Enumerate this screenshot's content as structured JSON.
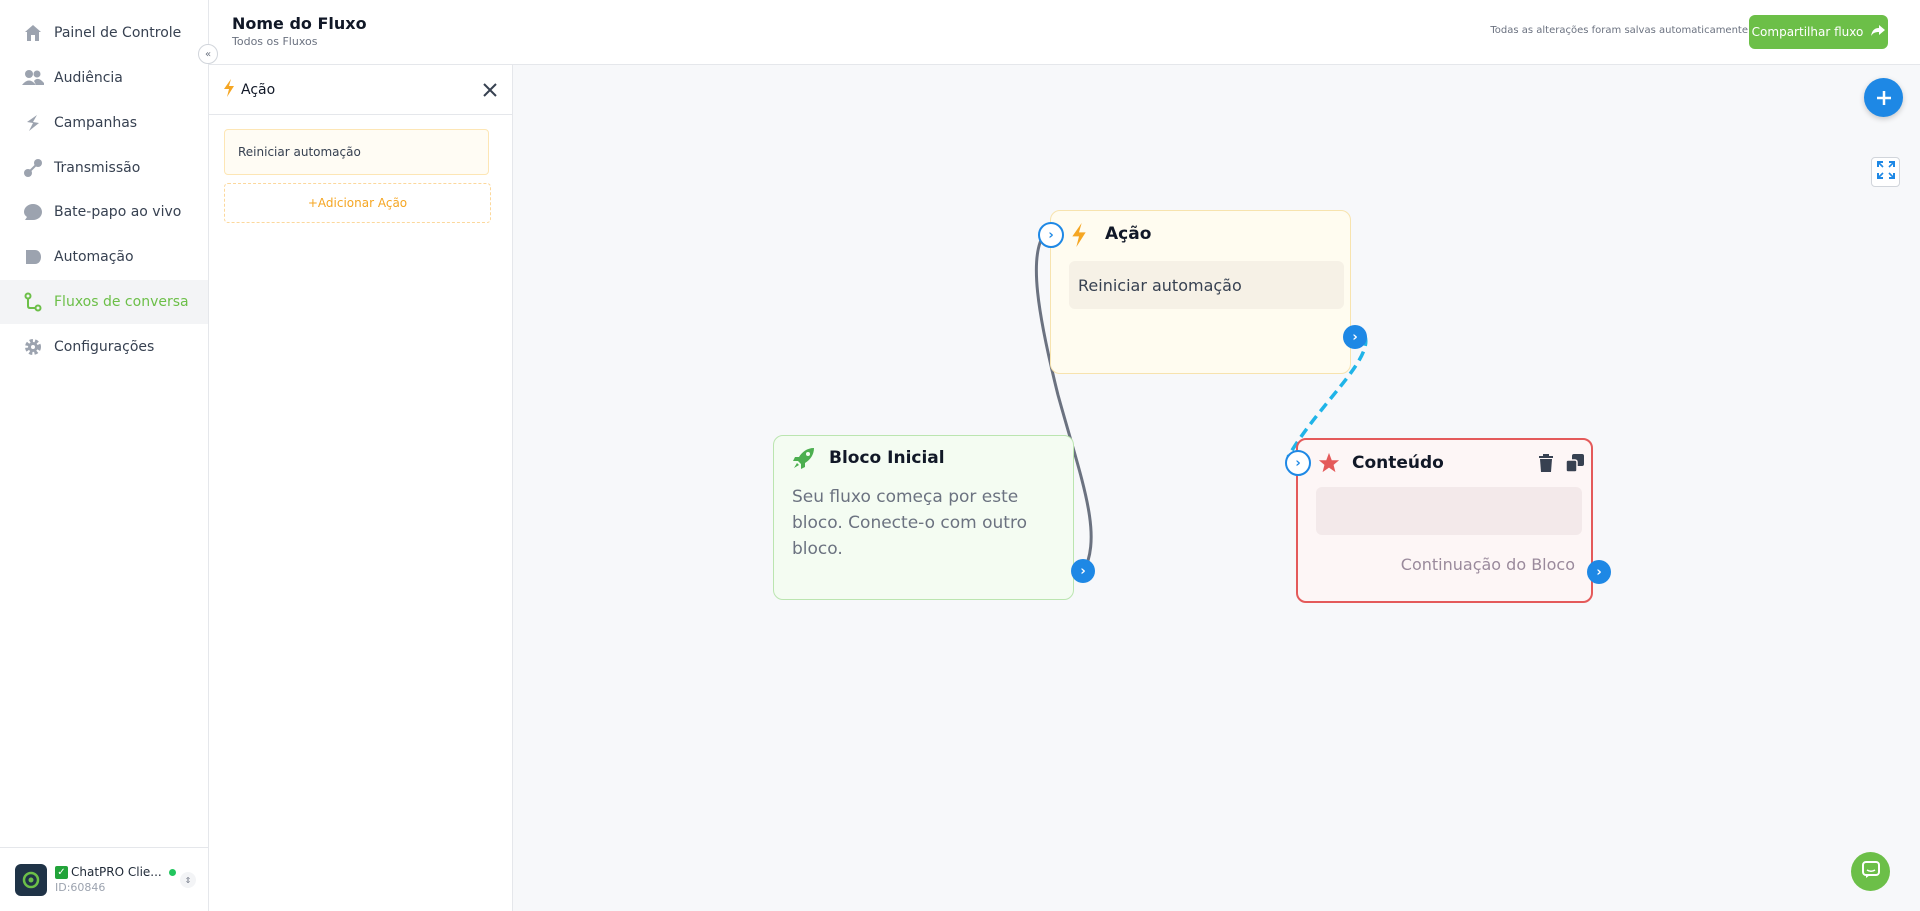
{
  "sidebar": {
    "items": [
      {
        "label": "Painel de Controle",
        "icon": "home-icon"
      },
      {
        "label": "Audiência",
        "icon": "users-icon"
      },
      {
        "label": "Campanhas",
        "icon": "campaigns-icon"
      },
      {
        "label": "Transmissão",
        "icon": "broadcast-icon"
      },
      {
        "label": "Bate-papo ao vivo",
        "icon": "chat-bubble-icon"
      },
      {
        "label": "Automação",
        "icon": "automation-icon"
      },
      {
        "label": "Fluxos de conversa",
        "icon": "flow-icon",
        "active": true
      },
      {
        "label": "Configurações",
        "icon": "gear-icon"
      }
    ],
    "collapse_icon": "double-chevron-left-icon",
    "account": {
      "name": "ChatPRO Clie...",
      "id": "ID:60846",
      "status_color": "#22c55e"
    }
  },
  "header": {
    "title": "Nome do Fluxo",
    "subtitle": "Todos os Fluxos",
    "saved_text": "Todas as alterações foram salvas automaticamente",
    "share_label": "Compartilhar fluxo"
  },
  "panel": {
    "title": "Ação",
    "action_item": "Reiniciar automação",
    "add_action": "+Adicionar Ação"
  },
  "canvas": {
    "nodes": {
      "action": {
        "title": "Ação",
        "item": "Reiniciar automação"
      },
      "start": {
        "title": "Bloco Inicial",
        "desc": "Seu fluxo começa por este bloco. Conecte-o com outro bloco."
      },
      "content": {
        "title": "Conteúdo",
        "continuation": "Continuação do Bloco"
      }
    }
  },
  "colors": {
    "brand": "#6cbf48",
    "accent_blue": "#1e88e5",
    "action_amber": "#f5a623",
    "content_red": "#e45a5a"
  }
}
